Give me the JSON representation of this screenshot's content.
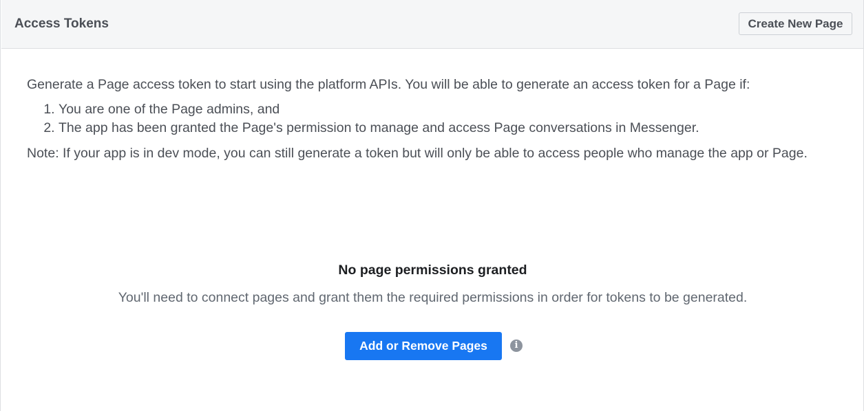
{
  "header": {
    "title": "Access Tokens",
    "create_button_label": "Create New Page"
  },
  "intro": {
    "description": "Generate a Page access token to start using the platform APIs. You will be able to generate an access token for a Page if:",
    "conditions": [
      "You are one of the Page admins, and",
      "The app has been granted the Page's permission to manage and access Page conversations in Messenger."
    ],
    "note": "Note: If your app is in dev mode, you can still generate a token but will only be able to access people who manage the app or Page."
  },
  "empty_state": {
    "title": "No page permissions granted",
    "description": "You'll need to connect pages and grant them the required permissions in order for tokens to be generated.",
    "button_label": "Add or Remove Pages",
    "info_icon": "info-icon",
    "info_glyph": "i"
  },
  "colors": {
    "primary_button": "#1877f2",
    "header_background": "#f5f6f7",
    "border": "#dddfe2",
    "text": "#4b4f56"
  }
}
